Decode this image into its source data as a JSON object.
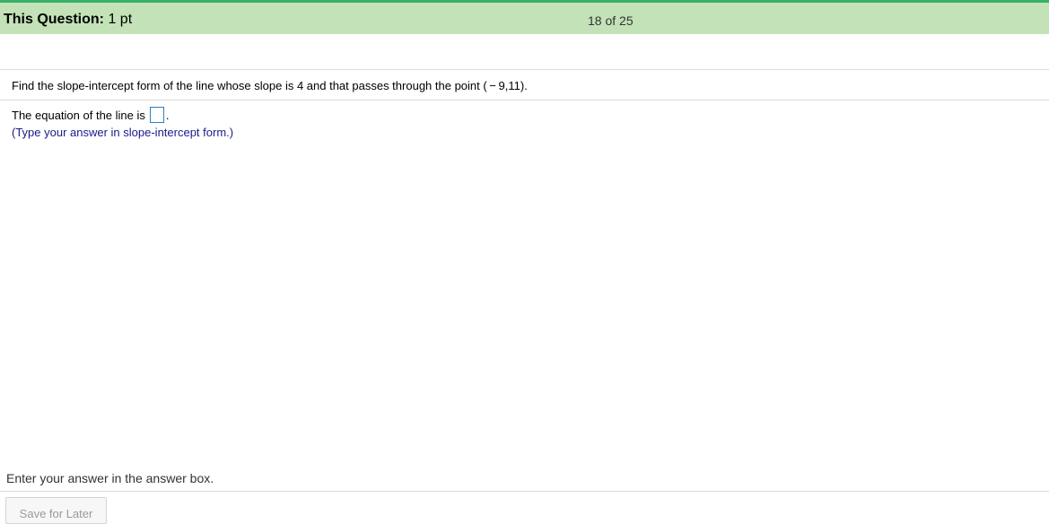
{
  "header": {
    "label": "This Question:",
    "points": "1 pt",
    "counter": "18 of 25"
  },
  "question": {
    "prompt": "Find the slope-intercept form of the line whose slope is 4 and that passes through the point ( − 9,11).",
    "answer_prefix": "The equation of the line is",
    "answer_suffix": ".",
    "answer_value": "",
    "hint": "(Type your answer in slope-intercept form.)"
  },
  "footer": {
    "status": "Enter your answer in the answer box.",
    "save_label": "Save for Later"
  }
}
